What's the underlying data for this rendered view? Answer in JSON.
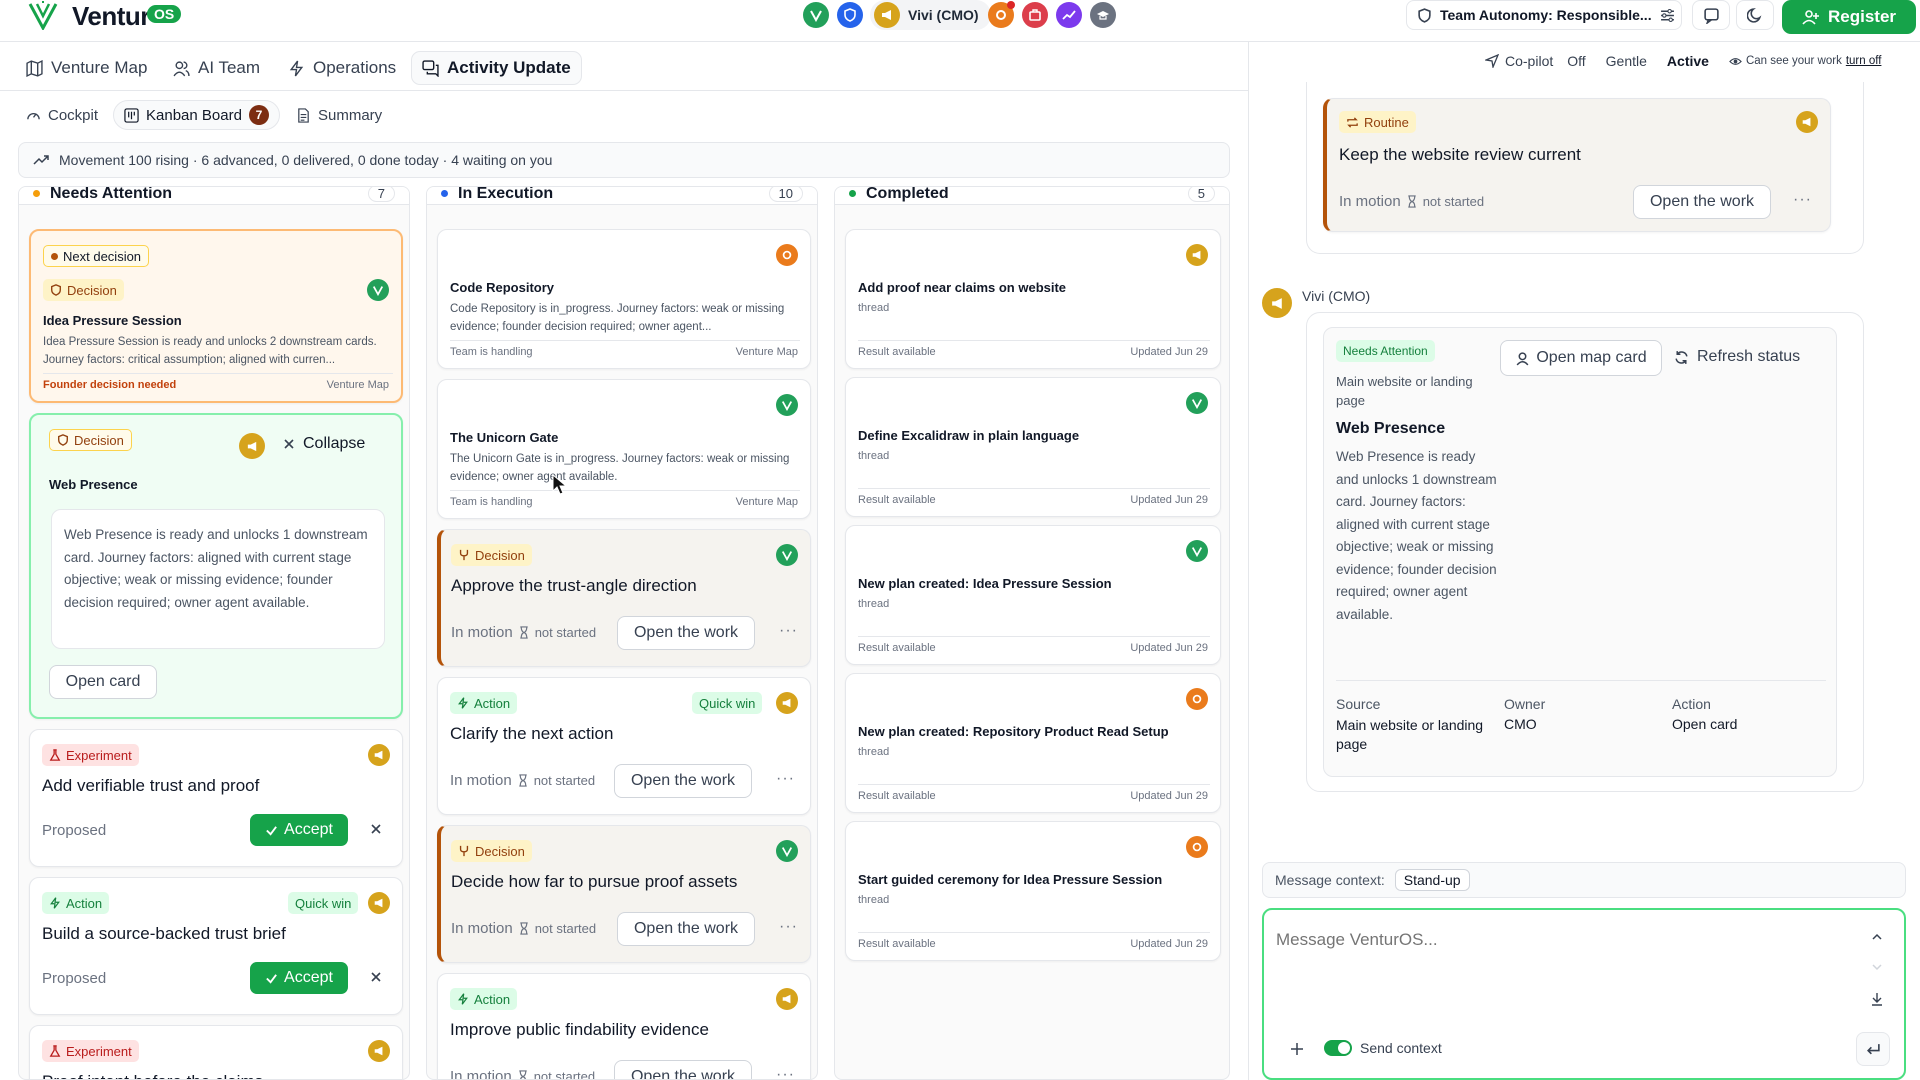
{
  "app": {
    "name": "Ventur",
    "badge": "OS"
  },
  "topbar": {
    "agents": [
      {
        "name": "vivi",
        "color": "#22a05a"
      },
      {
        "name": "shield-agent",
        "color": "#2563eb"
      },
      {
        "name": "megaphone-agent",
        "color": "#d6a31c"
      },
      {
        "name": "gear-agent",
        "color": "#ea7b1c"
      },
      {
        "name": "briefcase-agent",
        "color": "#dc3e4b"
      },
      {
        "name": "growth-agent",
        "color": "#7c3aed"
      },
      {
        "name": "graduate-agent",
        "color": "#6b7280"
      }
    ],
    "active_agent": "Vivi (CMO)",
    "team_pill": "Team Autonomy: Responsible...",
    "register": "Register"
  },
  "nav": {
    "tabs": [
      "Venture Map",
      "AI Team",
      "Operations",
      "Activity Update"
    ],
    "active": "Activity Update"
  },
  "subnav": {
    "tabs": [
      "Cockpit",
      "Kanban Board",
      "Summary"
    ],
    "kanban_count": "7"
  },
  "movement": "Movement 100 rising · 6 advanced, 0 delivered, 0 done today · 4 waiting on you",
  "columns": {
    "attention": {
      "title": "Needs Attention",
      "count": "7"
    },
    "execution": {
      "title": "In Execution",
      "count": "10"
    },
    "completed": {
      "title": "Completed",
      "count": "5"
    }
  },
  "attention_cards": {
    "c1": {
      "next": "Next decision",
      "tag": "Decision",
      "title": "Idea Pressure Session",
      "desc": "Idea Pressure Session is ready and unlocks 2 downstream cards. Journey factors: critical assumption; aligned with curren...",
      "status": "Founder decision needed",
      "source": "Venture Map"
    },
    "c2": {
      "tag": "Decision",
      "collapse": "Collapse",
      "title": "Web Presence",
      "desc": "Web Presence is ready and unlocks 1 downstream card. Journey factors: aligned with current stage objective; weak or missing evidence; founder decision required; owner agent available.",
      "open": "Open card"
    },
    "c3": {
      "tag": "Experiment",
      "title": "Add verifiable trust and proof",
      "status": "Proposed",
      "accept": "Accept"
    },
    "c4": {
      "tag": "Action",
      "quick": "Quick win",
      "title": "Build a source-backed trust brief",
      "status": "Proposed",
      "accept": "Accept"
    },
    "c5": {
      "tag": "Experiment",
      "title": "Proof intent before the claims"
    }
  },
  "execution_cards": {
    "e1": {
      "title": "Code Repository",
      "desc": "Code Repository is in_progress. Journey factors: weak or missing evidence; founder decision required; owner agent...",
      "status": "Team is handling",
      "source": "Venture Map"
    },
    "e2": {
      "title": "The Unicorn Gate",
      "desc": "The Unicorn Gate is in_progress. Journey factors: weak or missing evidence; owner agent available.",
      "status": "Team is handling",
      "source": "Venture Map"
    },
    "e3": {
      "tag": "Decision",
      "title": "Approve the trust-angle direction",
      "motion": "In motion",
      "ns": "not started",
      "open": "Open the work"
    },
    "e4": {
      "tag": "Action",
      "quick": "Quick win",
      "title": "Clarify the next action",
      "motion": "In motion",
      "ns": "not started",
      "open": "Open the work"
    },
    "e5": {
      "tag": "Decision",
      "title": "Decide how far to pursue proof assets",
      "motion": "In motion",
      "ns": "not started",
      "open": "Open the work"
    },
    "e6": {
      "tag": "Action",
      "title": "Improve public findability evidence",
      "motion": "In motion",
      "ns": "not started",
      "open": "Open the work"
    }
  },
  "completed_cards": [
    {
      "title": "Add proof near claims on website",
      "sub": "thread",
      "result": "Result available",
      "updated": "Updated Jun 29"
    },
    {
      "title": "Define Excalidraw in plain language",
      "sub": "thread",
      "result": "Result available",
      "updated": "Updated Jun 29"
    },
    {
      "title": "New plan created: Idea Pressure Session",
      "sub": "thread",
      "result": "Result available",
      "updated": "Updated Jun 29"
    },
    {
      "title": "New plan created: Repository Product Read Setup",
      "sub": "thread",
      "result": "Result available",
      "updated": "Updated Jun 29"
    },
    {
      "title": "Start guided ceremony for Idea Pressure Session",
      "sub": "thread",
      "result": "Result available",
      "updated": "Updated Jun 29"
    }
  ],
  "copilot": {
    "label": "Co-pilot",
    "modes": [
      "Off",
      "Gentle",
      "Active"
    ],
    "active_mode": "Active",
    "note": "Can see your work",
    "turn_off": "turn off"
  },
  "chat": {
    "routine": {
      "tag": "Routine",
      "title": "Keep the website review current",
      "motion": "In motion",
      "ns": "not started",
      "open": "Open the work"
    },
    "sender": "Vivi (CMO)",
    "card": {
      "tag": "Needs Attention",
      "subtitle": "Main website or landing page",
      "open_map": "Open map card",
      "refresh": "Refresh status",
      "title": "Web Presence",
      "desc": "Web Presence is ready and unlocks 1 downstream card. Journey factors: aligned with current stage objective; weak or missing evidence; founder decision required; owner agent available.",
      "source_label": "Source",
      "source_val": "Main website or landing page",
      "owner_label": "Owner",
      "owner_val": "CMO",
      "action_label": "Action",
      "action_val": "Open card"
    },
    "context_label": "Message context:",
    "context_val": "Stand-up",
    "placeholder": "Message VenturOS...",
    "send_context": "Send context"
  }
}
